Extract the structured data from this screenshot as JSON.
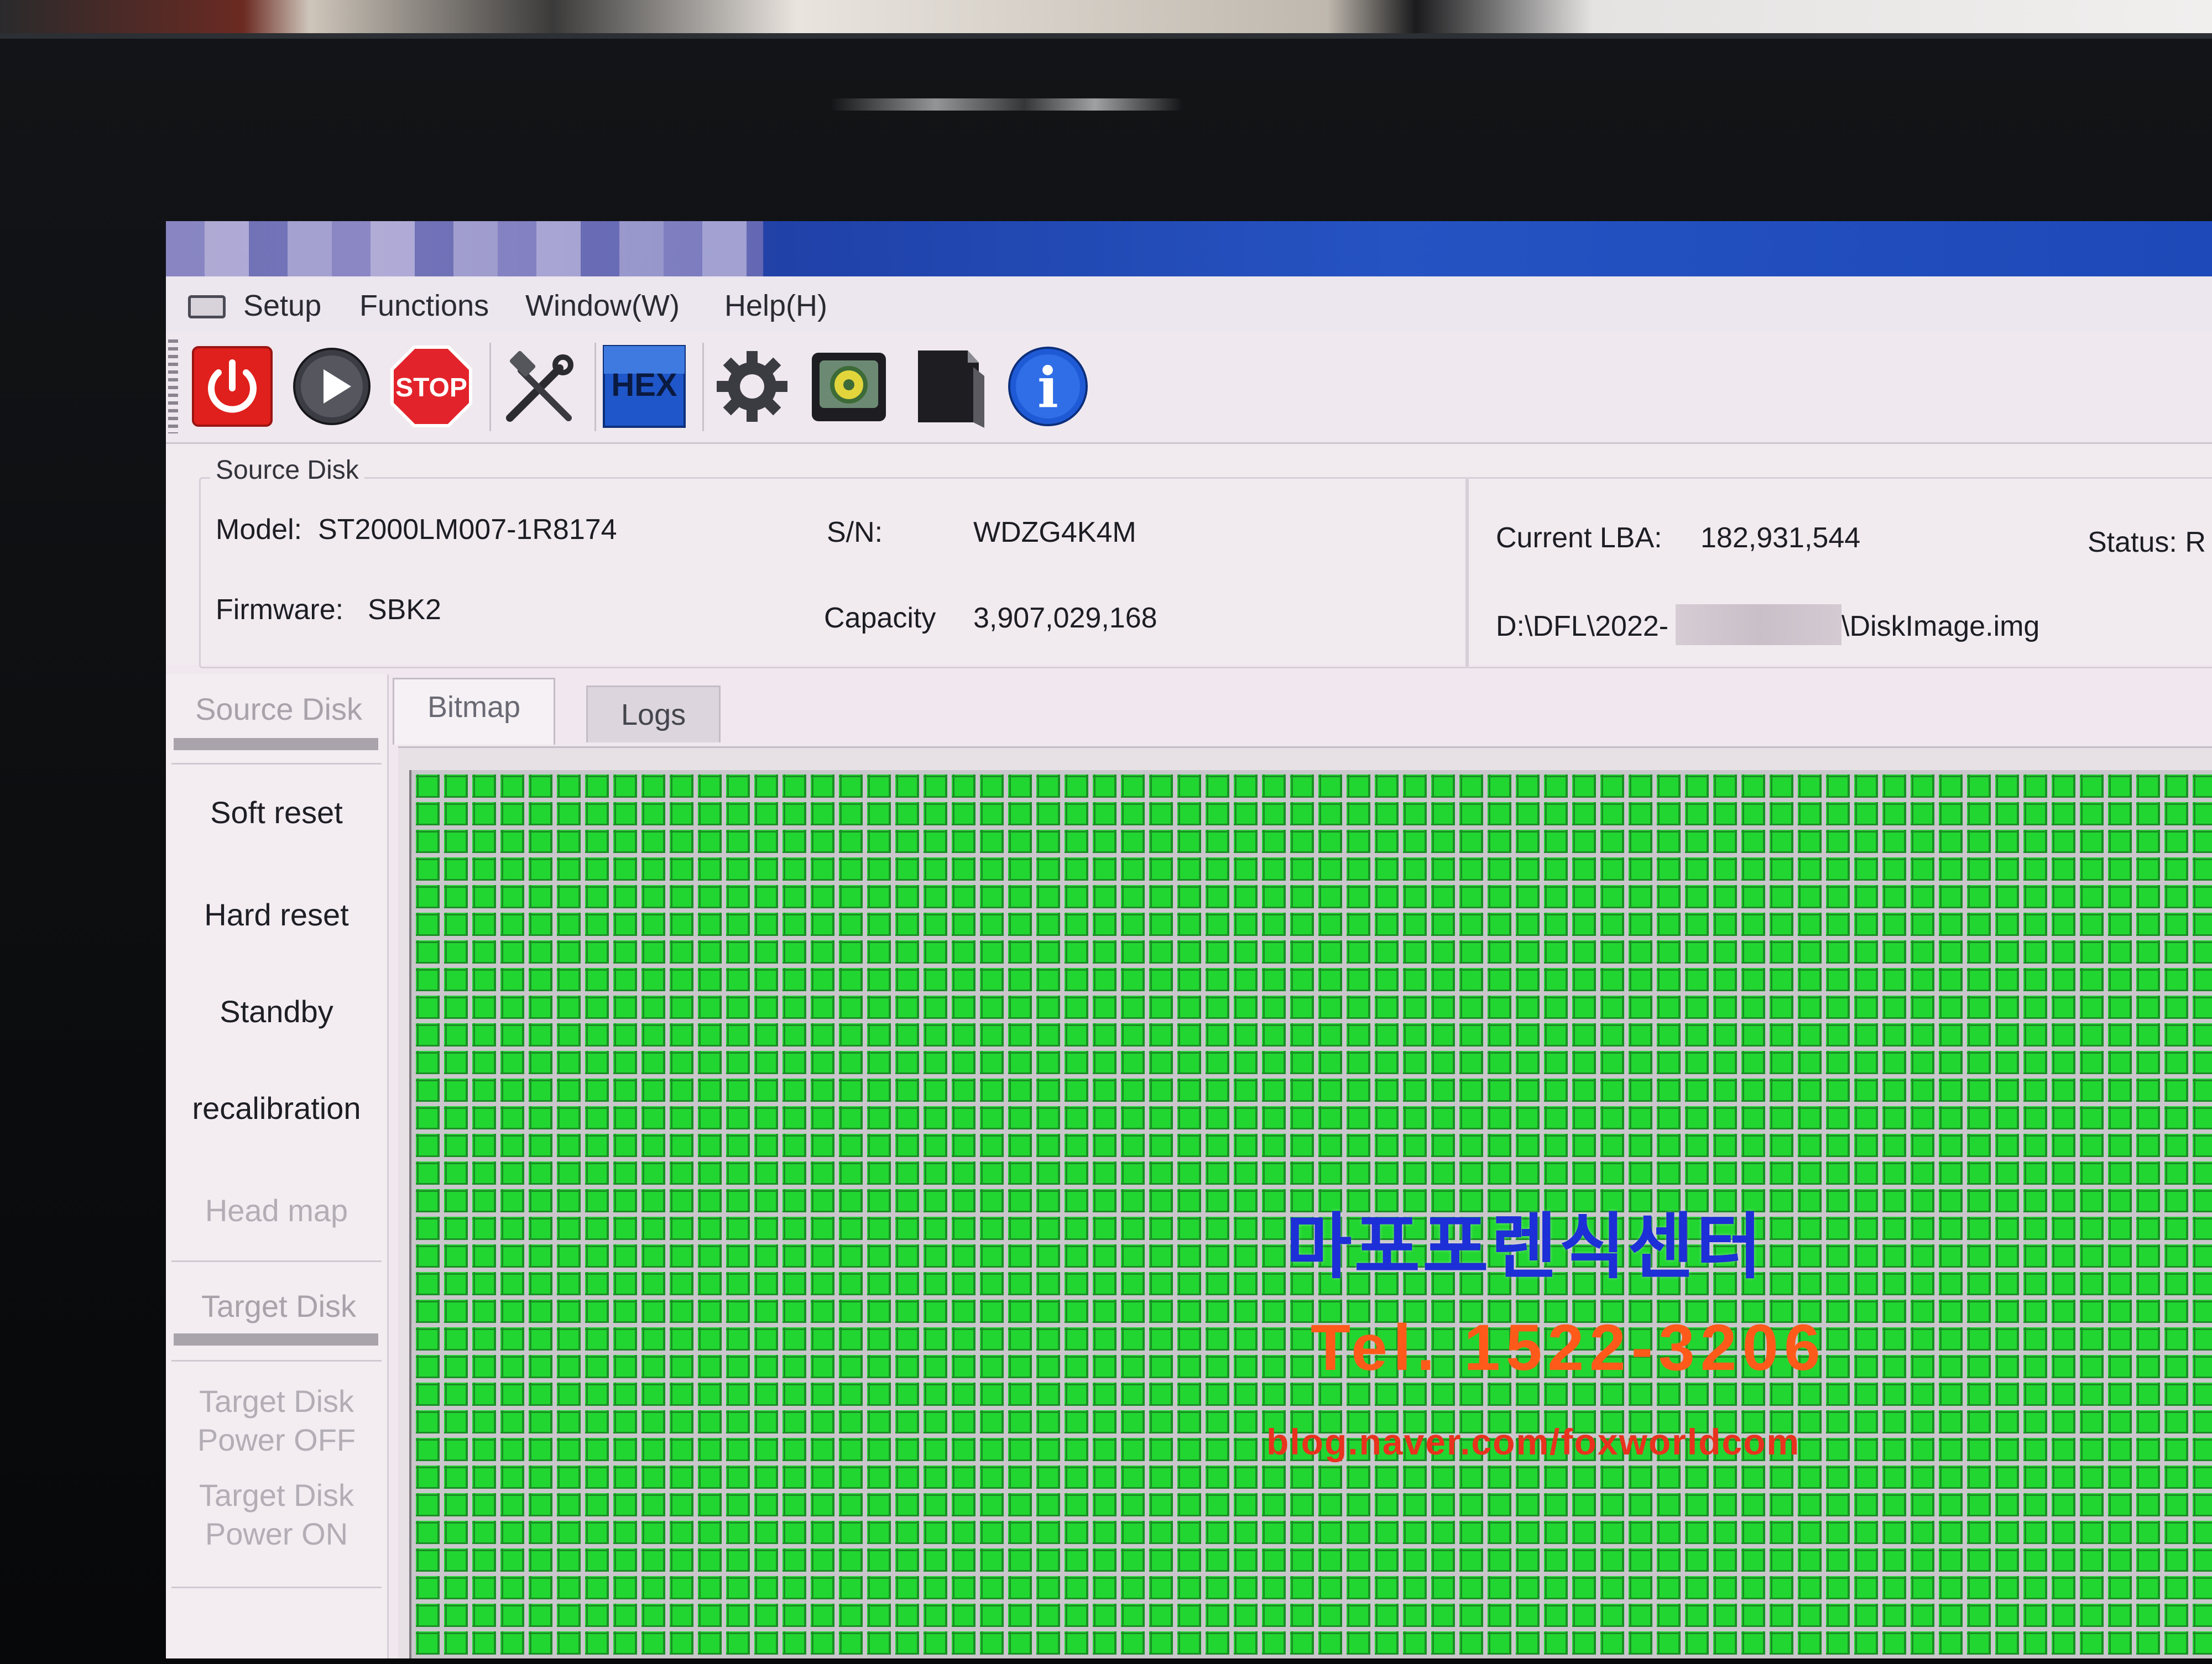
{
  "menu": {
    "items": [
      "Setup",
      "Functions",
      "Window(W)",
      "Help(H)"
    ]
  },
  "toolbar": {
    "buttons": [
      {
        "icon": "power-icon",
        "color": "#e0201c"
      },
      {
        "icon": "play-icon",
        "color": "#3c3c44"
      },
      {
        "icon": "stop-icon",
        "label": "STOP",
        "color": "#e3232b"
      },
      {
        "icon": "tools-icon"
      },
      {
        "icon": "hex-icon",
        "label": "HEX",
        "color": "#1f56c9"
      },
      {
        "icon": "gear-icon"
      },
      {
        "icon": "disk-image-icon"
      },
      {
        "icon": "file-icon"
      },
      {
        "icon": "info-icon",
        "label": "i",
        "color": "#1f5ad6"
      }
    ]
  },
  "source_disk": {
    "group_title": "Source Disk",
    "model_label": "Model:",
    "model_value": "ST2000LM007-1R8174",
    "sn_label": "S/N:",
    "sn_value": "WDZG4K4M",
    "firmware_label": "Firmware:",
    "firmware_value": "SBK2",
    "capacity_label": "Capacity",
    "capacity_value": "3,907,029,168",
    "current_lba_label": "Current LBA:",
    "current_lba_value": "182,931,544",
    "status_label": "Status: R",
    "path_prefix": "D:\\DFL\\2022-",
    "path_suffix": "\\DiskImage.img"
  },
  "side_panel": {
    "source_header": "Source Disk",
    "soft_reset": "Soft reset",
    "hard_reset": "Hard reset",
    "standby": "Standby",
    "recalibration": "recalibration",
    "head_map": "Head map",
    "target_header": "Target Disk",
    "target_power_off_1": "Target Disk",
    "target_power_off_2": "Power OFF",
    "target_power_on_1": "Target Disk",
    "target_power_on_2": "Power ON"
  },
  "tabs": {
    "bitmap": "Bitmap",
    "logs": "Logs"
  },
  "bitmap": {
    "cell_color": "#22d631",
    "all_blocks_state": "read-ok"
  },
  "watermark": {
    "name": "마포포렌식센터",
    "tel": "Tel. 1522-3206",
    "blog": "blog.naver.com/foxworldcom"
  }
}
